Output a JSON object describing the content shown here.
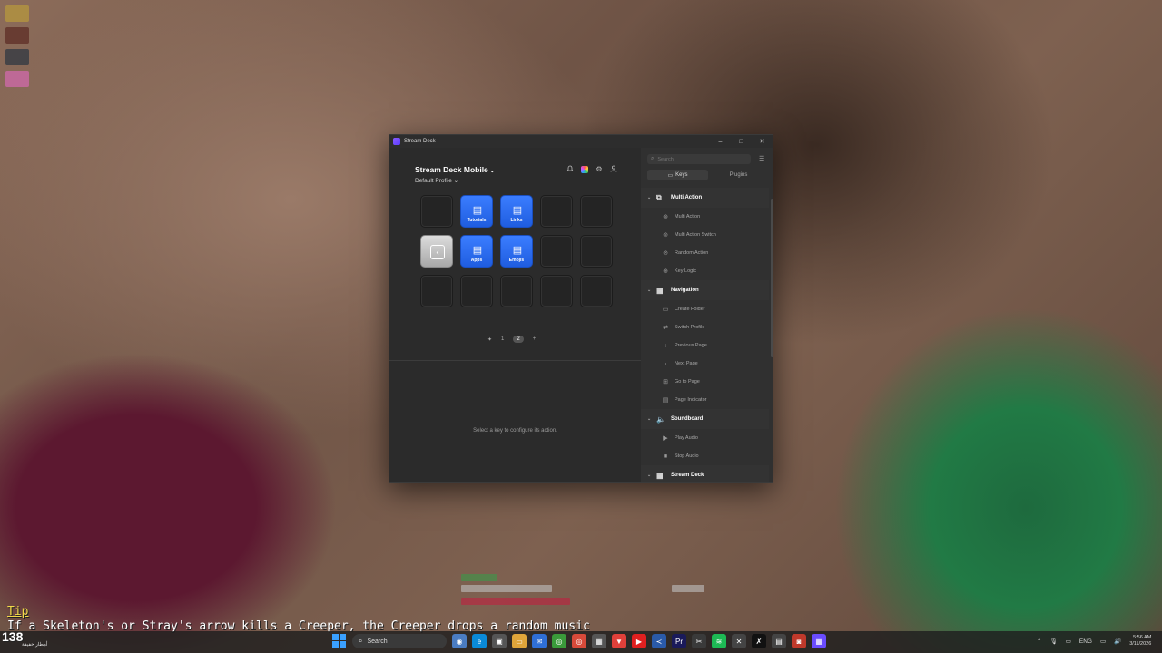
{
  "window": {
    "title": "Stream Deck",
    "minimize": "–",
    "maximize": "□",
    "close": "✕"
  },
  "header": {
    "device": "Stream Deck Mobile",
    "profile": "Default Profile",
    "icons": {
      "bell": "bell-icon",
      "marketplace": "marketplace-icon",
      "settings": "gear-icon",
      "account": "user-icon"
    }
  },
  "keys": [
    {
      "type": "empty"
    },
    {
      "type": "blue",
      "label": "Tutorials",
      "icon": "folder-icon"
    },
    {
      "type": "blue",
      "label": "Links",
      "icon": "folder-icon"
    },
    {
      "type": "empty"
    },
    {
      "type": "empty"
    },
    {
      "type": "back",
      "icon": "back-icon"
    },
    {
      "type": "blue",
      "label": "Apps",
      "icon": "folder-icon"
    },
    {
      "type": "blue",
      "label": "Emojis",
      "icon": "folder-icon"
    },
    {
      "type": "empty"
    },
    {
      "type": "empty"
    },
    {
      "type": "empty"
    },
    {
      "type": "empty"
    },
    {
      "type": "empty"
    },
    {
      "type": "empty"
    },
    {
      "type": "empty"
    }
  ],
  "pager": {
    "prev": "✦",
    "pages": [
      "1",
      "2"
    ],
    "current": "2",
    "add": "+"
  },
  "inspector": {
    "hint": "Select a key to configure its action."
  },
  "sidebar": {
    "search_placeholder": "Search",
    "tabs": [
      {
        "label": "Keys",
        "active": true
      },
      {
        "label": "Plugins",
        "active": false
      }
    ],
    "categories": [
      {
        "name": "Multi Action",
        "items": [
          "Multi Action",
          "Multi Action Switch",
          "Random Action",
          "Key Logic"
        ]
      },
      {
        "name": "Navigation",
        "items": [
          "Create Folder",
          "Switch Profile",
          "Previous Page",
          "Next Page",
          "Go to Page",
          "Page Indicator"
        ]
      },
      {
        "name": "Soundboard",
        "items": [
          "Play Audio",
          "Stop Audio"
        ]
      },
      {
        "name": "Stream Deck",
        "items": []
      }
    ]
  },
  "game": {
    "tip_title": "Tip",
    "tip_text": "If a Skeleton's or Stray's arrow kills a Creeper, the Creeper drops a random music",
    "count": "138"
  },
  "taskbar": {
    "left_text": "أمطار خفيفة",
    "search": "Search",
    "language": "ENG",
    "time": "5:56 AM",
    "date": "3/11/2026"
  },
  "colors": {
    "accent": "#2a6bf2",
    "window_bg": "#2b2b2b",
    "sidebar_bg": "#303030"
  }
}
